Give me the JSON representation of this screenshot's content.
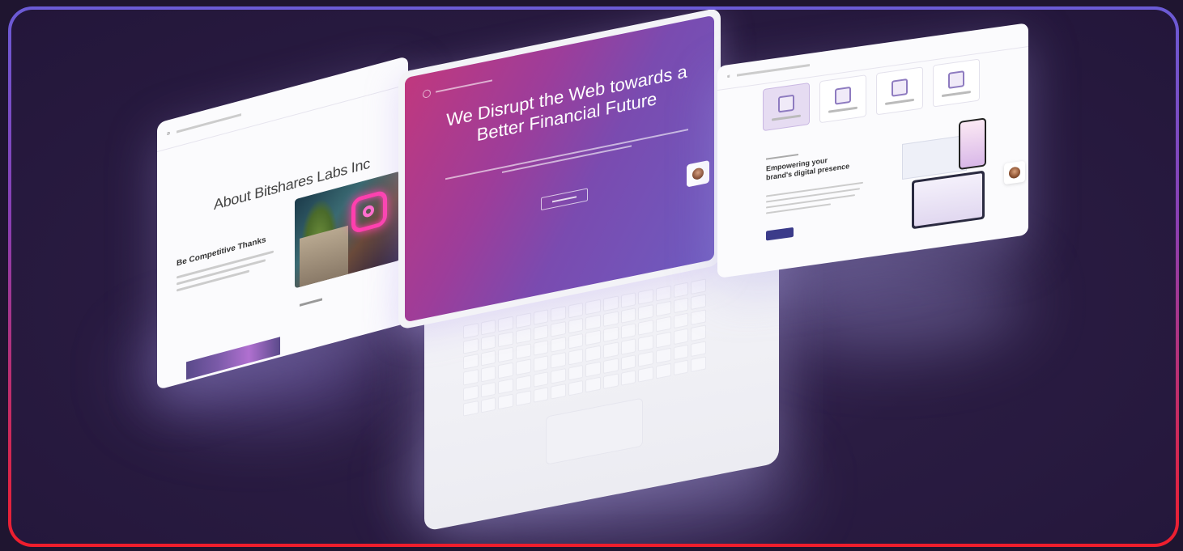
{
  "left_panel": {
    "title": "About Bitshares Labs Inc",
    "subheading": "Be Competitive Thanks"
  },
  "laptop_screen": {
    "headline": "We Disrupt the Web towards a Better Financial Future"
  },
  "right_panel": {
    "heading": "Empowering your brand's digital presence"
  },
  "colors": {
    "background": "#23163a",
    "border_gradient_start": "#6b5bd6",
    "border_gradient_end": "#f01e2c",
    "hero_gradient_start": "#c0387e",
    "hero_gradient_end": "#6e5bbf"
  }
}
